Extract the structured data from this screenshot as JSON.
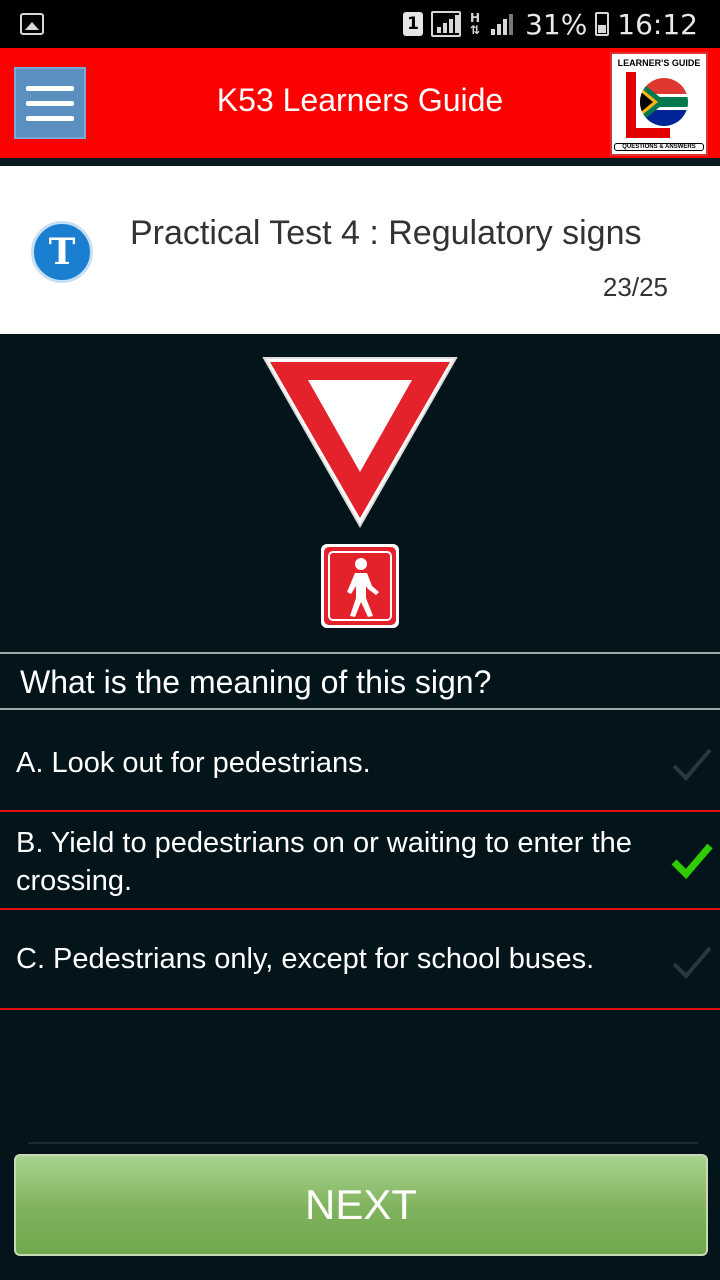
{
  "status_bar": {
    "sim_slot": "1",
    "network_type": "H",
    "battery_percent": "31%",
    "time": "16:12"
  },
  "app_bar": {
    "title": "K53 Learners Guide",
    "menu_icon": "hamburger-icon",
    "logo": {
      "top_text": "LEARNER'S GUIDE",
      "bottom_text": "QUESTIONS & ANSWERS"
    },
    "colors": {
      "background": "#fd0000"
    }
  },
  "test": {
    "badge_letter": "T",
    "title": "Practical Test 4 : Regulatory signs",
    "progress": "23/25"
  },
  "question": {
    "text": "What is the meaning of this sign?",
    "sign": "yield-to-pedestrians-sign"
  },
  "options": [
    {
      "label": "A. Look out for pedestrians.",
      "correct": false
    },
    {
      "label": "B. Yield to pedestrians on or waiting to enter the crossing.",
      "correct": true
    },
    {
      "label": "C. Pedestrians only, except for school buses.",
      "correct": false
    }
  ],
  "next_button": {
    "label": "NEXT"
  }
}
